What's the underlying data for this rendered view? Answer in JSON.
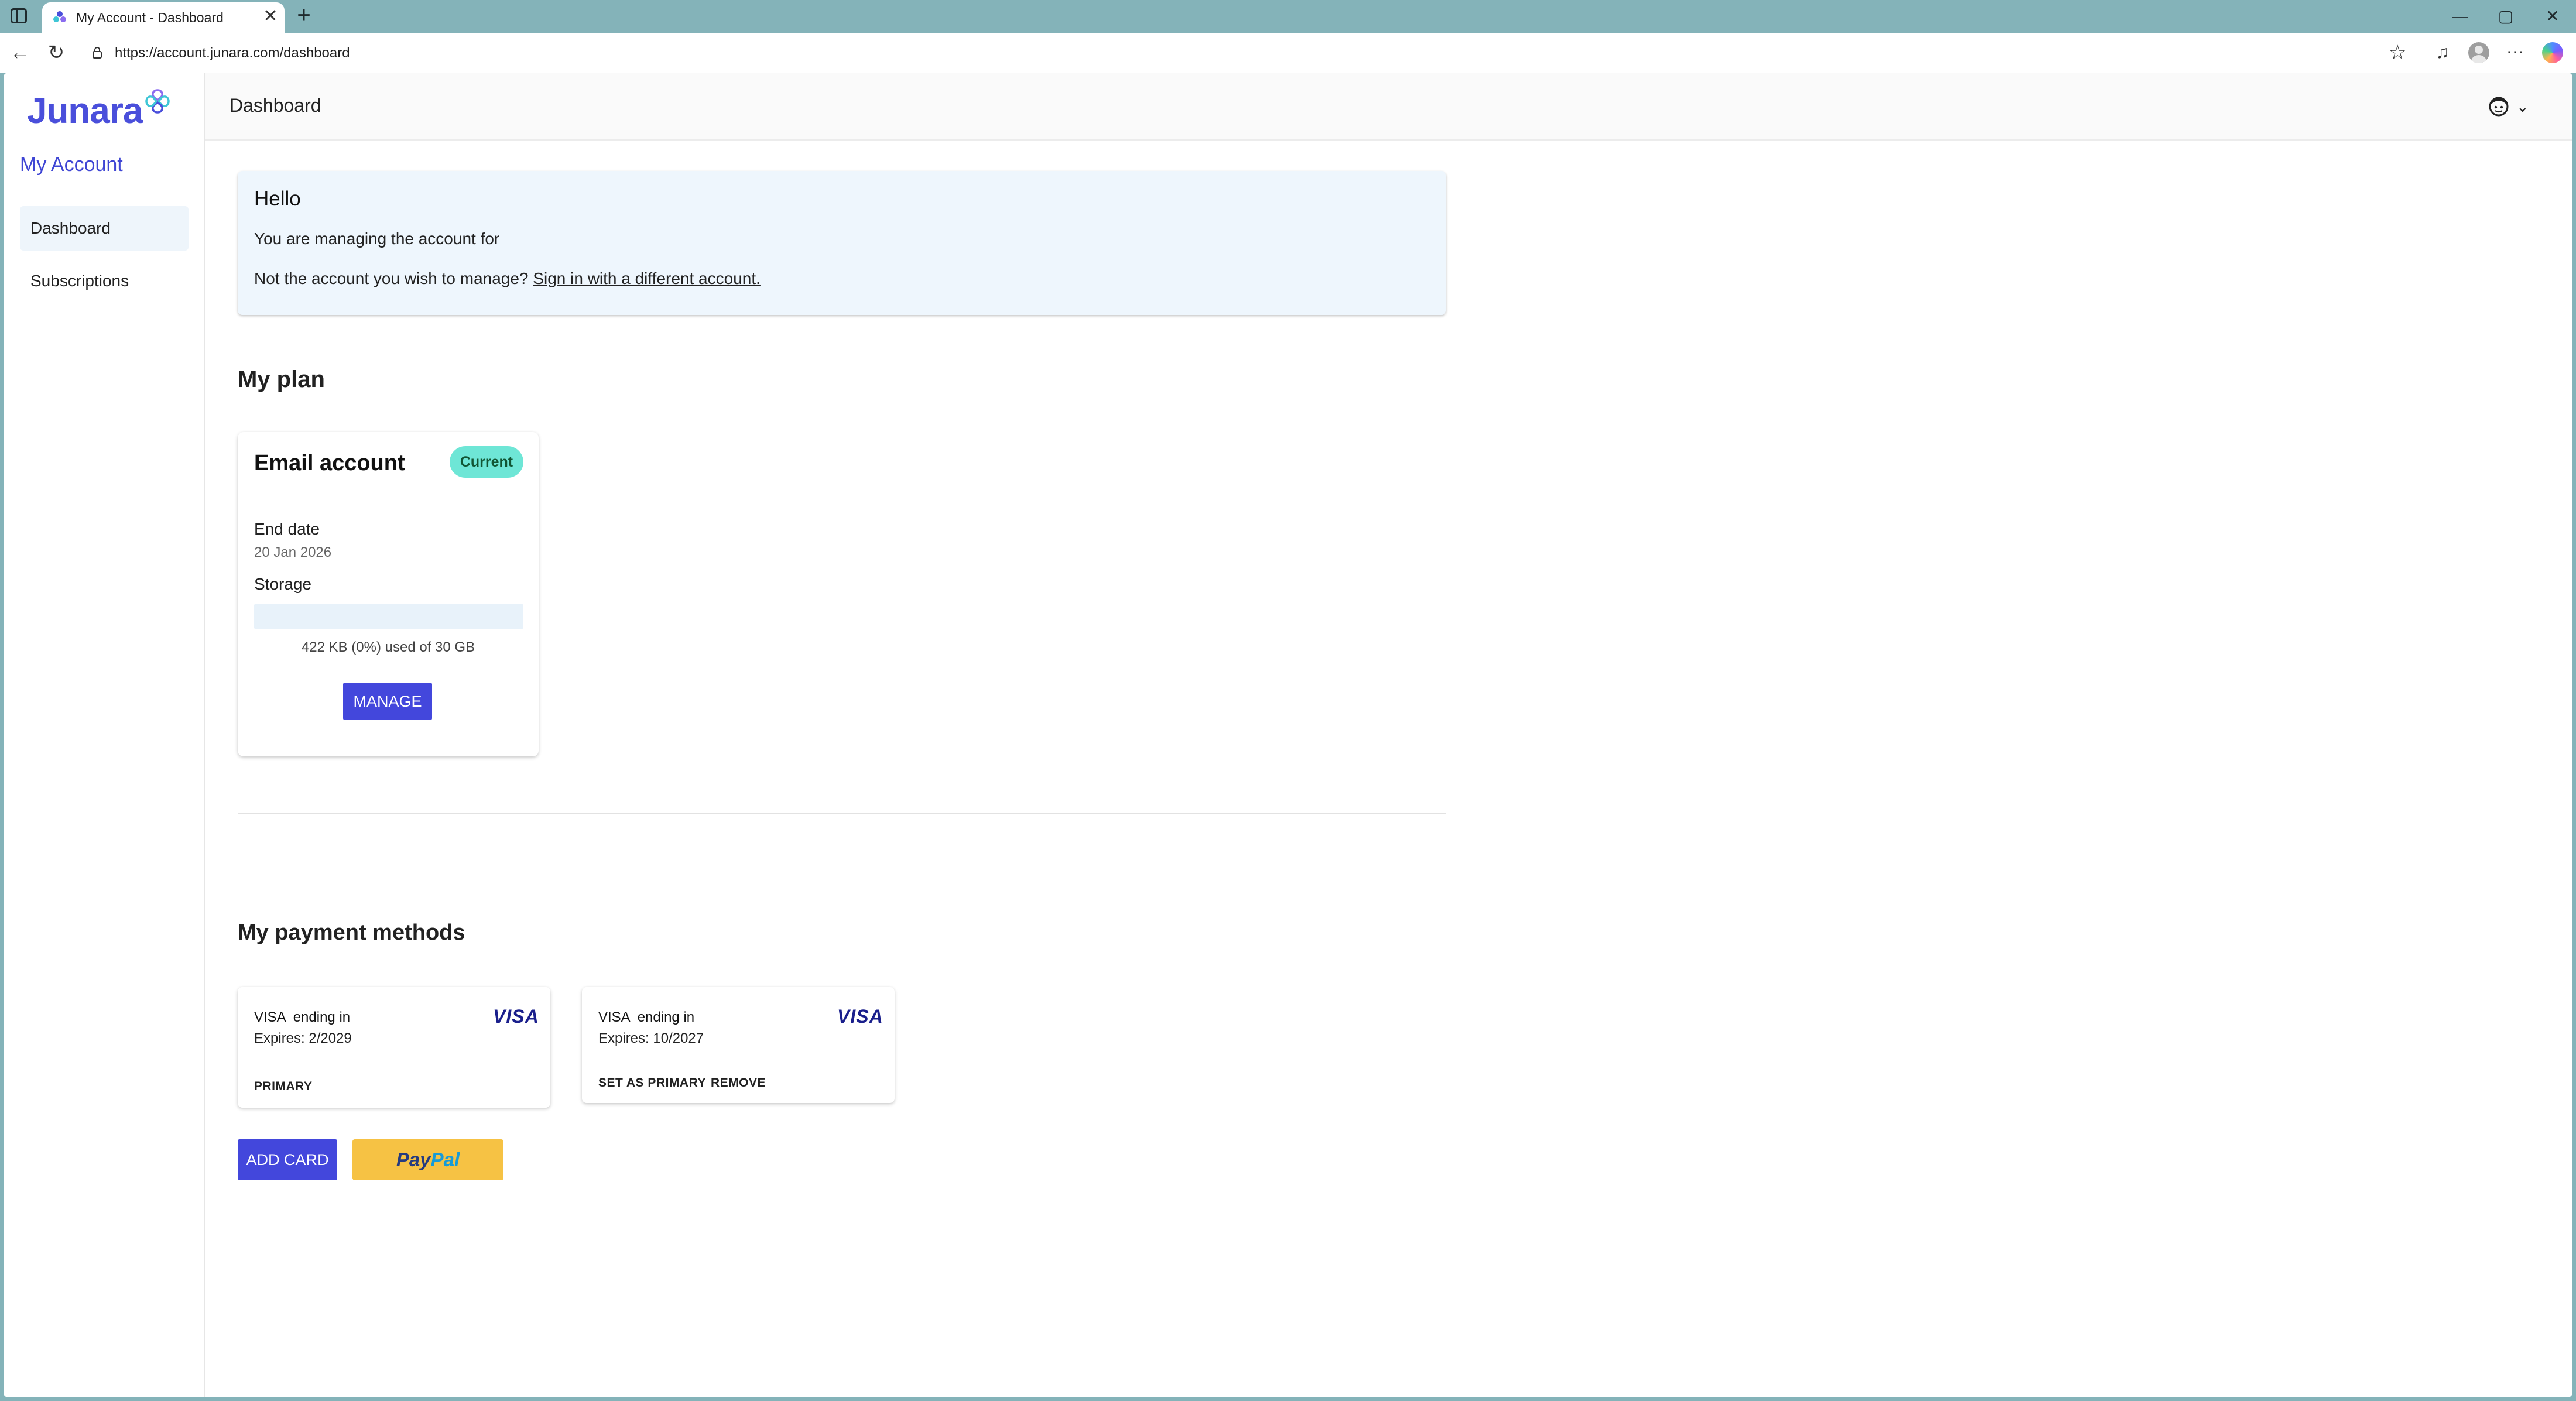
{
  "browser": {
    "tab_title": "My Account - Dashboard",
    "tab_close": "✕",
    "new_tab": "+",
    "url": "https://account.junara.com/dashboard",
    "window_controls": [
      "—",
      "▢",
      "✕"
    ],
    "icons": [
      "sidebar-toggle-icon",
      "favicon-icon",
      "back-icon",
      "reload-icon",
      "lock-icon",
      "star-icon",
      "extension-icon",
      "profile-icon",
      "more-icon",
      "copilot-icon"
    ]
  },
  "sidebar": {
    "logo_text": "Junara",
    "heading": "My Account",
    "items": [
      {
        "label": "Dashboard",
        "active": true
      },
      {
        "label": "Subscriptions",
        "active": false
      }
    ]
  },
  "header": {
    "title": "Dashboard",
    "user_menu_chevron": "⌄"
  },
  "hello": {
    "title": "Hello",
    "managing_text": "You are managing the account for",
    "not_account_text": "Not the account you wish to manage?",
    "switch_link": "Sign in with a different account."
  },
  "plan": {
    "heading": "My plan",
    "name": "Email account",
    "badge": "Current",
    "end_date_label": "End date",
    "end_date_value": "20 Jan 2026",
    "storage_label": "Storage",
    "storage_used_fraction": 0,
    "storage_text": "422 KB (0%) used of 30 GB",
    "manage_button": "MANAGE"
  },
  "payments": {
    "heading": "My payment methods",
    "cards": [
      {
        "brand": "VISA  ending in",
        "expires": "Expires: 2/2029",
        "logo": "VISA",
        "actions": [
          "PRIMARY"
        ]
      },
      {
        "brand": "VISA  ending in",
        "expires": "Expires: 10/2027",
        "logo": "VISA",
        "actions": [
          "SET AS PRIMARY",
          "REMOVE"
        ]
      }
    ],
    "add_card_button": "ADD CARD",
    "paypal_part1": "Pay",
    "paypal_part2": "Pal"
  },
  "colors": {
    "accent": "#4347dc",
    "badge": "#6ee6d6",
    "hello_bg": "#eef6fd",
    "chrome": "#84b3b9",
    "paypal": "#f6c244"
  }
}
